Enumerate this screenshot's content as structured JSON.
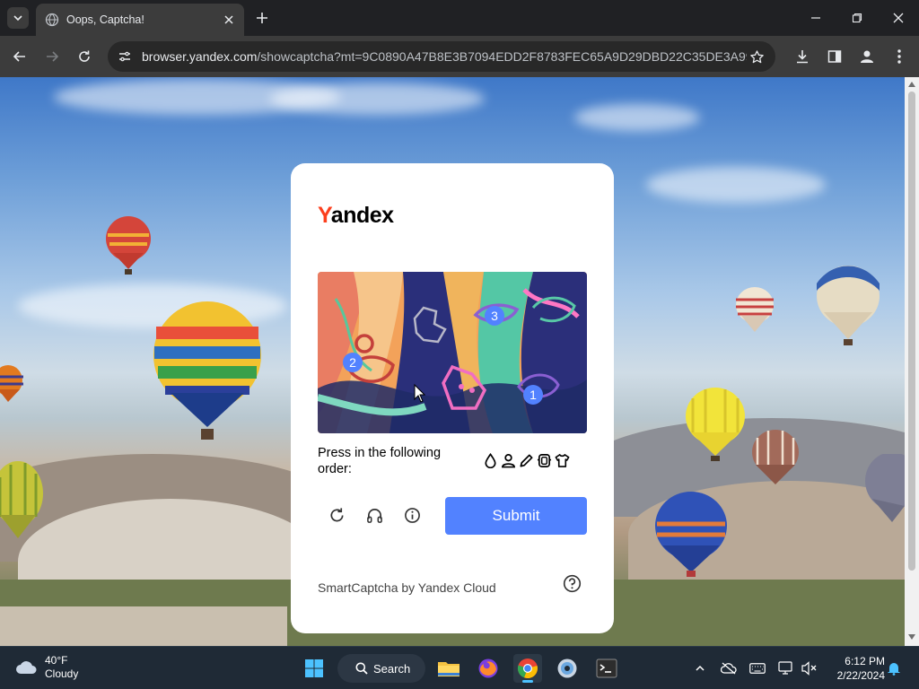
{
  "browser": {
    "tab_title": "Oops, Captcha!",
    "url_host": "browser.yandex.com",
    "url_path": "/showcaptcha?mt=9C0890A47B8E3B7094EDD2F8783FEC65A9D29DBD22C35DE3A998..."
  },
  "captcha": {
    "logo_first": "Y",
    "logo_rest": "andex",
    "marks": [
      "3",
      "2",
      "1"
    ],
    "instruction": "Press in the following order:",
    "order_icons": [
      "drop-icon",
      "person-icon",
      "pencil-icon",
      "robot-icon",
      "tshirt-icon"
    ],
    "submit_label": "Submit",
    "footer": "SmartCaptcha by Yandex Cloud",
    "accent_color": "#5282ff"
  },
  "taskbar": {
    "temperature": "40°F",
    "condition": "Cloudy",
    "search_label": "Search",
    "time": "6:12 PM",
    "date": "2/22/2024"
  }
}
